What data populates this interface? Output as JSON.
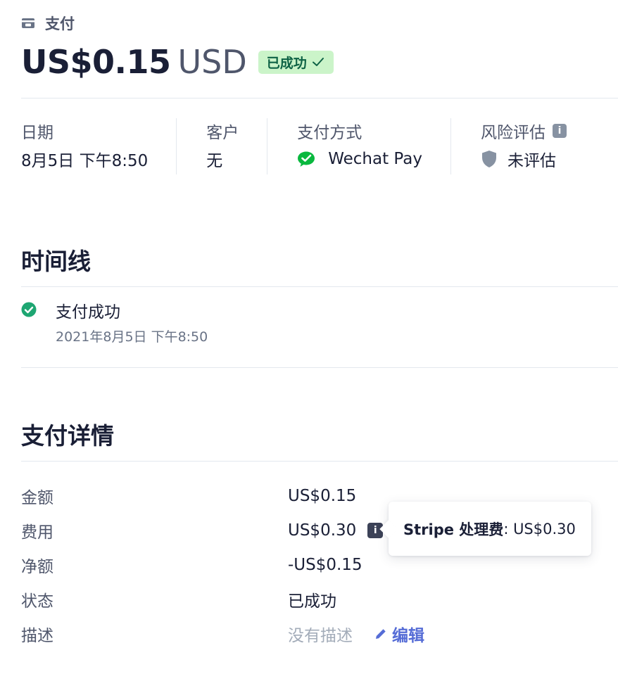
{
  "header": {
    "breadcrumb": "支付",
    "amount": "US$0.15",
    "currency": "USD",
    "status_badge": "已成功"
  },
  "summary": {
    "date_label": "日期",
    "date_value": "8月5日 下午8:50",
    "customer_label": "客户",
    "customer_value": "无",
    "payment_method_label": "支付方式",
    "payment_method_value": "Wechat Pay",
    "risk_label": "风险评估",
    "risk_value": "未评估"
  },
  "timeline": {
    "title": "时间线",
    "items": [
      {
        "title": "支付成功",
        "time": "2021年8月5日 下午8:50"
      }
    ]
  },
  "details": {
    "title": "支付详情",
    "rows": [
      {
        "label": "金额",
        "value": "US$0.15"
      },
      {
        "label": "费用",
        "value": "US$0.30"
      },
      {
        "label": "净额",
        "value": "-US$0.15"
      },
      {
        "label": "状态",
        "value": "已成功"
      },
      {
        "label": "描述",
        "value": "没有描述"
      }
    ],
    "edit_label": "编辑"
  },
  "tooltip": {
    "strong": "Stripe 处理费",
    "rest": ": US$0.30"
  },
  "colors": {
    "success_badge_bg": "#cbf4c9",
    "success_badge_text": "#0e6245",
    "success_check": "#1ea672",
    "wechat_green": "#09b83e",
    "link": "#556cd6"
  },
  "icons": {
    "breadcrumb": "payment-card-icon",
    "badge": "checkmark-icon",
    "risk_info": "info-icon",
    "wechat": "wechat-icon",
    "risk": "shield-icon",
    "timeline": "check-circle-icon",
    "fee_info": "info-icon",
    "edit": "pencil-icon"
  }
}
